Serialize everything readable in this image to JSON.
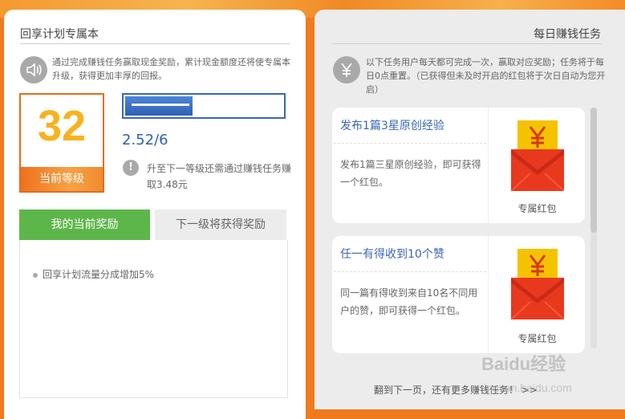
{
  "left": {
    "title": "回享计划专属本",
    "description": "通过完成赚钱任务赢取现金奖励，累计现金额度还将使专属本升级，获得更加丰厚的回报。",
    "level": {
      "number": "32",
      "label": "当前等级"
    },
    "progress": {
      "current": 2.52,
      "target": 6,
      "text": "2.52/6",
      "fraction": 0.42
    },
    "upgrade_note": "升至下一等级还需通过赚钱任务赚取3.48元",
    "tabs": [
      {
        "label": "我的当前奖励",
        "active": true
      },
      {
        "label": "下一级将获得奖励",
        "active": false
      }
    ],
    "rewards": [
      "回享计划流量分成增加5%"
    ]
  },
  "right": {
    "title": "每日赚钱任务",
    "description": "以下任务用户每天都可完成一次，赢取对应奖励；任务将于每日0点重置。（已获得但未及时开启的红包将于次日自动为您开启）",
    "tasks": [
      {
        "title": "发布1篇3星原创经验",
        "description": "发布1篇三星原创经验，即可获得一个红包。",
        "reward_label": "专属红包"
      },
      {
        "title": "任一有得收到10个赞",
        "description": "同一篇有得收到来自10名不同用户的赞，即可获得一个红包。",
        "reward_label": "专属红包"
      }
    ],
    "footer": "翻到下一页，还有更多赚钱任务！ >>"
  },
  "icons": {
    "speaker": "speaker-icon",
    "yuan": "yuan-icon",
    "info": "exclamation-icon",
    "envelope": "red-envelope-icon"
  },
  "watermark": {
    "text": "Baidu经验",
    "url": "jingyan.baidu.com"
  },
  "colors": {
    "orange": "#f07a1e",
    "green_tab": "#5db64a",
    "blue": "#3a67b5",
    "level_gold": "#f6b31e"
  }
}
